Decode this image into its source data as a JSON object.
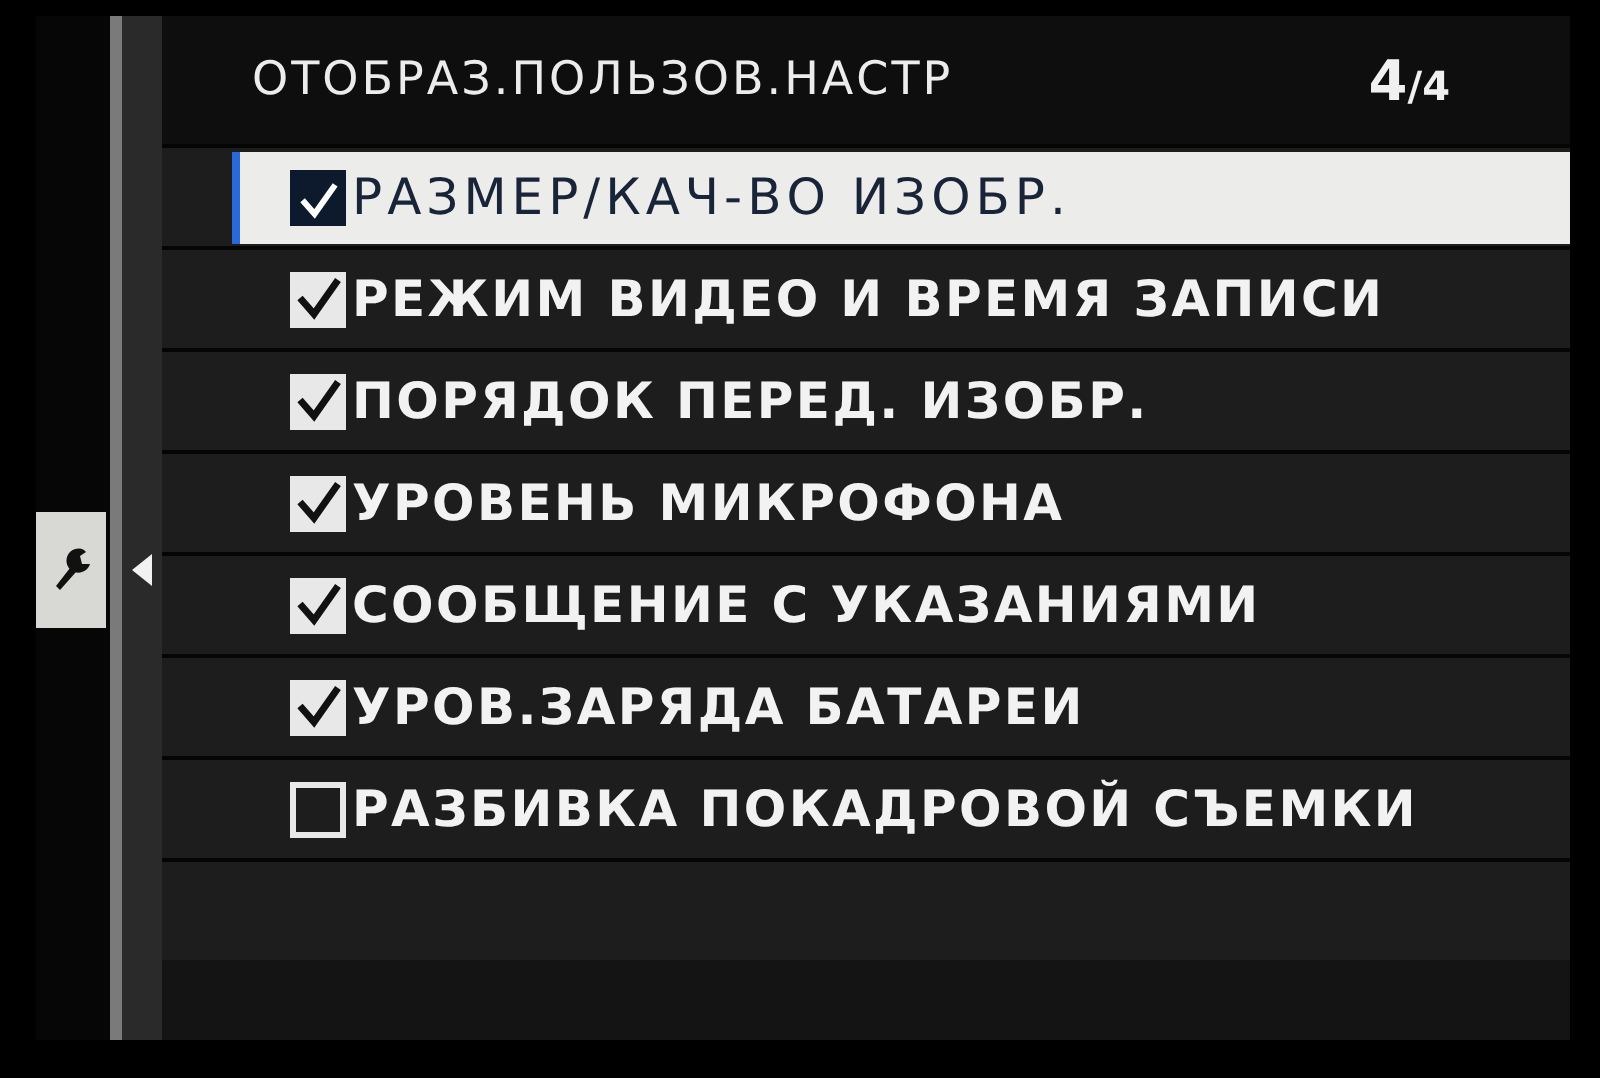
{
  "header": {
    "title": "ОТОБРАЗ.ПОЛЬЗОВ.НАСТР",
    "page": "4",
    "page_total": "/4"
  },
  "sidebar": {
    "tabs": [
      {
        "kind": "wrench",
        "selected": true
      }
    ]
  },
  "items": [
    {
      "label": "РАЗМЕР/КАЧ-ВО ИЗОБР.",
      "checked": true,
      "selected": true
    },
    {
      "label": "РЕЖИМ ВИДЕО И ВРЕМЯ ЗАПИСИ",
      "checked": true,
      "selected": false
    },
    {
      "label": "ПОРЯДОК ПЕРЕД. ИЗОБР.",
      "checked": true,
      "selected": false
    },
    {
      "label": "УРОВЕНЬ МИКРОФОНА",
      "checked": true,
      "selected": false
    },
    {
      "label": "СООБЩЕНИЕ С УКАЗАНИЯМИ",
      "checked": true,
      "selected": false
    },
    {
      "label": "УРОВ.ЗАРЯДА БАТАРЕИ",
      "checked": true,
      "selected": false
    },
    {
      "label": "РАЗБИВКА ПОКАДРОВОЙ СЪЕМКИ",
      "checked": false,
      "selected": false
    }
  ]
}
